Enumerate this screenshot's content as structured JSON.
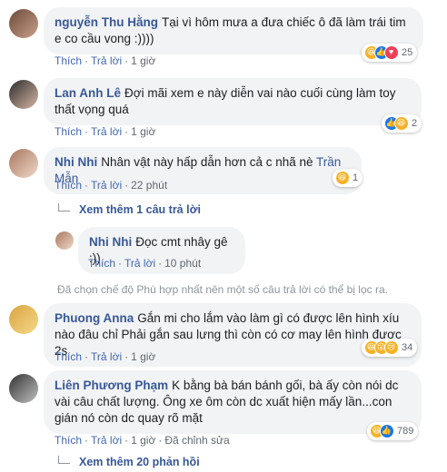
{
  "comments": [
    {
      "author": "nguyễn Thu Hằng",
      "text": "Tại vì hôm mưa a đưa chiếc ô đã làm trái tim e co cầu vong :))))",
      "actions": {
        "like": "Thích",
        "reply": "Trả lời",
        "time": "1 giờ"
      },
      "reactions": {
        "count": "25",
        "icons": [
          "haha-icon",
          "like-icon",
          "love-icon"
        ]
      }
    },
    {
      "author": "Lan Anh Lê",
      "text": "Đợi mãi xem e này diễn vai nào cuối cùng làm toy thất vọng quá",
      "actions": {
        "like": "Thích",
        "reply": "Trả lời",
        "time": "1 giờ"
      },
      "reactions": {
        "count": "2",
        "icons": [
          "like-icon",
          "haha-icon"
        ]
      }
    },
    {
      "author": "Nhi Nhi",
      "text": "Nhân vật này hấp dẫn hơn cả c nhã nè ",
      "mention": "Trần Mẫn",
      "actions": {
        "like": "Thích",
        "reply": "Trả lời",
        "time": "22 phút"
      },
      "reactions": {
        "count": "1",
        "icons": [
          "haha-icon"
        ]
      },
      "more_replies": "Xem thêm 1 câu trả lời",
      "reply": {
        "author": "Nhi Nhi",
        "text": "Đọc cmt nhây gê :))",
        "actions": {
          "like": "Thích",
          "reply": "Trả lời",
          "time": "10 phút"
        }
      }
    },
    {
      "author": "Phuong Anna",
      "text": "Gắn mi cho lắm vào làm gì có được lên hình xíu nào đâu chỉ Phải gắn sau lưng thì còn có cơ may lên hình được 2s",
      "actions": {
        "like": "Thích",
        "reply": "Trả lời",
        "time": "1 giờ"
      },
      "reactions": {
        "count": "34",
        "icons": [
          "haha-icon",
          "wow-icon",
          "sad-icon"
        ]
      }
    },
    {
      "author": "Liên Phương Phạm",
      "text": "K bằng bà bán bánh gối, bà ấy còn nói dc vài câu chất lượng. Ông xe ôm còn dc xuất hiện mấy lần...con gián nó còn dc quay rõ mặt",
      "actions": {
        "like": "Thích",
        "reply": "Trả lời",
        "time": "1 giờ",
        "edited": "Đã chỉnh sửa"
      },
      "reactions": {
        "count": "789",
        "icons": [
          "haha-icon",
          "like-icon"
        ]
      }
    }
  ],
  "filter_note": "Đã chọn chế độ Phù hợp nhất nên một số câu trả lời có thể bị lọc ra.",
  "more_replies_bottom": "Xem thêm 20 phản hồi",
  "colors": {
    "link": "#385898",
    "bubble": "#f2f3f5",
    "meta": "#606770"
  }
}
